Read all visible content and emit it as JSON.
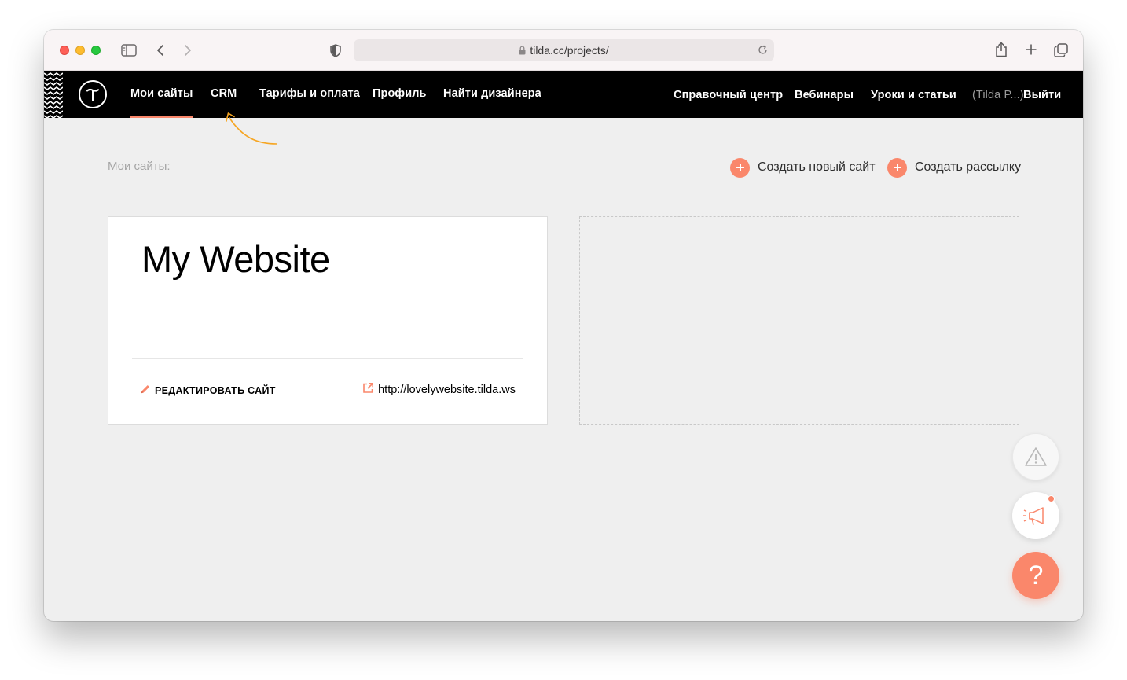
{
  "browser": {
    "url": "tilda.cc/projects/"
  },
  "nav": {
    "left_items": [
      {
        "label": "Мои сайты",
        "active": true
      },
      {
        "label": "CRM",
        "active": false
      },
      {
        "label": "Тарифы и оплата",
        "active": false
      },
      {
        "label": "Профиль",
        "active": false
      },
      {
        "label": "Найти дизайнера",
        "active": false
      }
    ],
    "right_items": [
      {
        "label": "Справочный центр"
      },
      {
        "label": "Вебинары"
      },
      {
        "label": "Уроки и статьи"
      }
    ],
    "user": "(Tilda P...)",
    "logout": "Выйти"
  },
  "page": {
    "label": "Мои сайты:",
    "create_site": "Создать новый сайт",
    "create_mailing": "Создать рассылку"
  },
  "site_card": {
    "title": "My Website",
    "edit_label": "РЕДАКТИРОВАТЬ САЙТ",
    "url": "http://lovelywebsite.tilda.ws"
  },
  "fab": {
    "help_glyph": "?"
  },
  "colors": {
    "accent": "#fa876b",
    "nav_bg": "#000000",
    "page_bg": "#efefef",
    "annotation_arrow": "#f6a623"
  }
}
